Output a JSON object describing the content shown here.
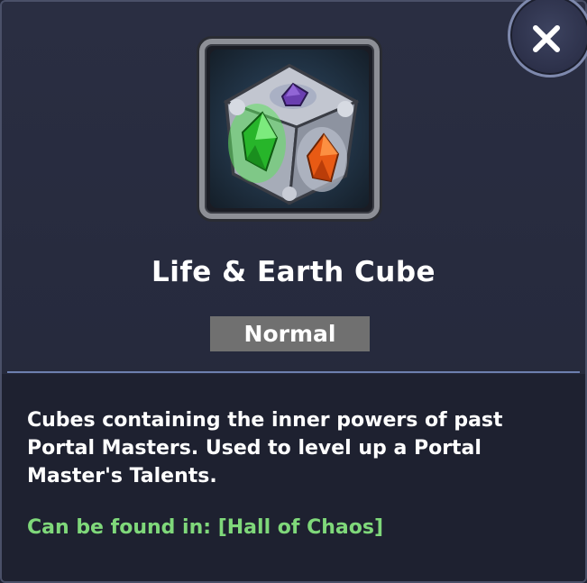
{
  "item": {
    "name": "Life & Earth Cube",
    "rarity": "Normal",
    "description": "Cubes containing the inner powers of past Portal Masters. Used to level up a Portal Master's Talents.",
    "location_text": "Can be found in: [Hall of Chaos]",
    "icon": "life-earth-cube-icon"
  },
  "close_button": {
    "icon": "close-icon"
  },
  "colors": {
    "panel_background": "#262a3d",
    "panel_border": "#4a5068",
    "rarity_badge": "#707070",
    "divider": "#6d7fae",
    "location_text": "#7fd87a",
    "gem_green": "#3ed43e",
    "gem_orange": "#e85a14",
    "gem_purple": "#6a3fb0"
  }
}
